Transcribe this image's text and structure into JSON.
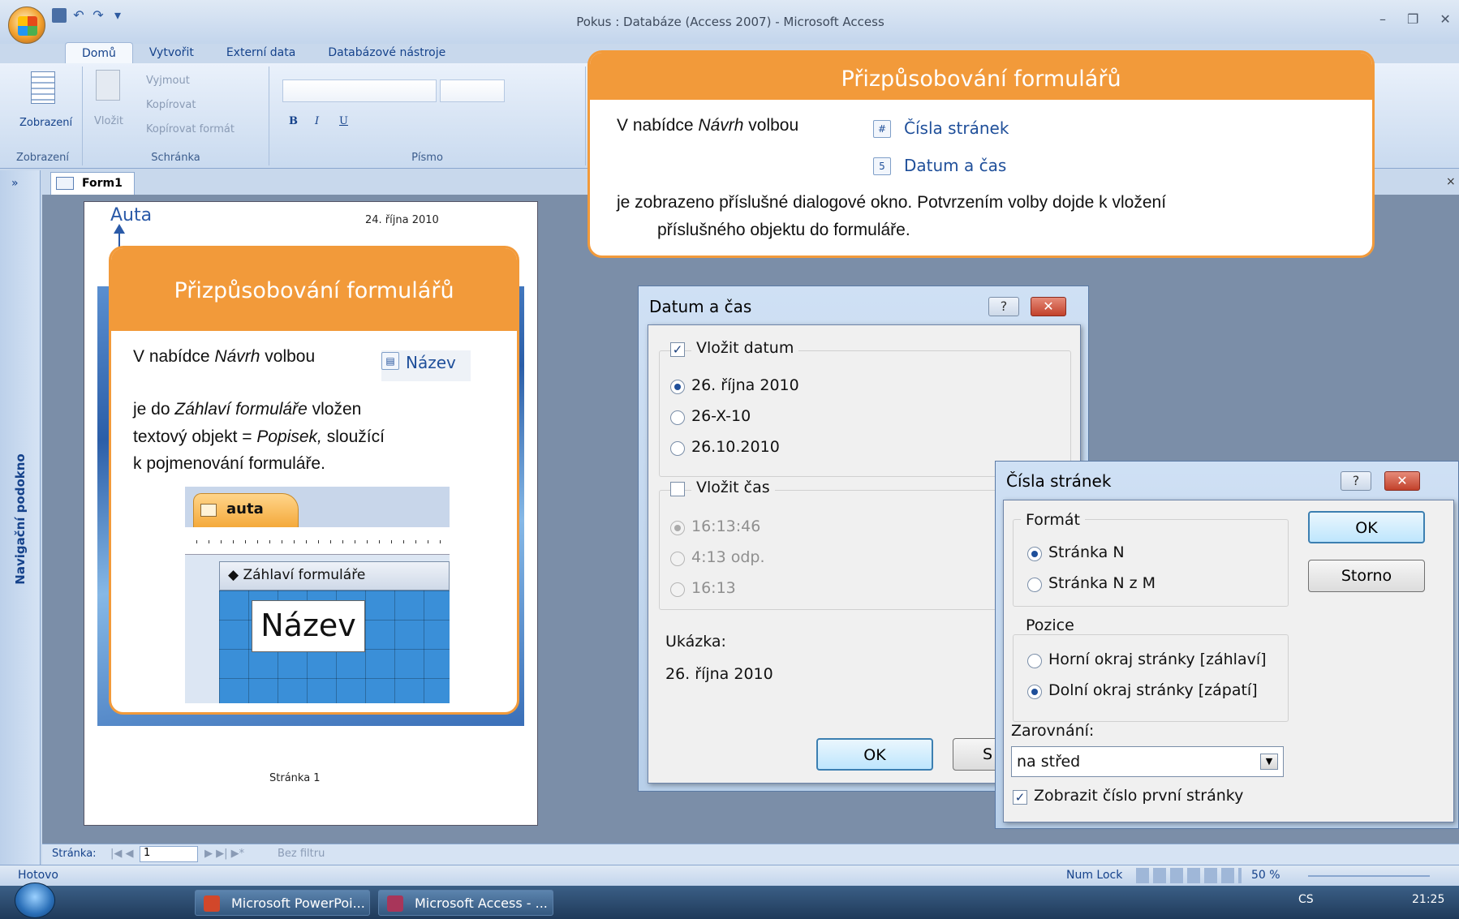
{
  "window": {
    "title": "Pokus : Databáze (Access 2007) - Microsoft Access"
  },
  "ribbon_tabs": [
    "Domů",
    "Vytvořit",
    "Externí data",
    "Databázové nástroje"
  ],
  "ribbon": {
    "views": {
      "button": "Zobrazení",
      "group": "Zobrazení"
    },
    "clipboard": {
      "paste": "Vložit",
      "cut": "Vyjmout",
      "copy": "Kopírovat",
      "format_painter": "Kopírovat formát",
      "group": "Schránka"
    },
    "font": {
      "group": "Písmo",
      "bold": "B",
      "italic": "I",
      "underline": "U"
    }
  },
  "nav_pane": {
    "label": "Navigační podokno",
    "toggle": "»"
  },
  "document": {
    "tab": "Form1"
  },
  "page": {
    "heading": "Auta",
    "date": "24. října 2010",
    "footer": "Stránka 1"
  },
  "callout_left": {
    "title": "Přizpůsobování formulářů",
    "line1_a": "V nabídce ",
    "line1_b": "Návrh",
    "line1_c": " volbou",
    "cmd": "Název",
    "p2_a": "je do  ",
    "p2_b": "Záhlaví formuláře",
    "p2_c": " vložen",
    "p2_d": "textový objekt = ",
    "p2_e": "Popisek,",
    "p2_f": " sloužící",
    "p2_g": "k pojmenování formuláře.",
    "thumb_tab": "auta",
    "thumb_section": "Záhlaví formuláře",
    "thumb_label": "Název"
  },
  "callout_top": {
    "title": "Přizpůsobování formulářů",
    "line1_a": "V nabídce ",
    "line1_b": "Návrh",
    "line1_c": " volbou",
    "cmd1": "Čísla stránek",
    "cmd2": "Datum a čas",
    "line2": "je zobrazeno  příslušné dialogové okno. Potvrzením volby dojde k vložení",
    "line3": "příslušného objektu do formuláře."
  },
  "dialog_datetime": {
    "title": "Datum a čas",
    "include_date": "Vložit datum",
    "date_opts": [
      "26. října 2010",
      "26-X-10",
      "26.10.2010"
    ],
    "include_time": "Vložit čas",
    "time_opts": [
      "16:13:46",
      "4:13 odp.",
      "16:13"
    ],
    "preview_label": "Ukázka:",
    "preview_value": "26. října 2010",
    "ok": "OK",
    "cancel_partial": "S"
  },
  "dialog_pages": {
    "title": "Čísla stránek",
    "format_label": "Formát",
    "format_opts": [
      "Stránka N",
      "Stránka N z M"
    ],
    "position_label": "Pozice",
    "position_opts": [
      "Horní okraj stránky [záhlaví]",
      "Dolní okraj stránky [zápatí]"
    ],
    "align_label": "Zarovnání:",
    "align_value": "na střed",
    "show_first": "Zobrazit číslo první stránky",
    "ok": "OK",
    "cancel": "Storno"
  },
  "record_nav": {
    "label": "Stránka:",
    "value": "1",
    "filter": "Bez filtru"
  },
  "status": {
    "left": "Hotovo",
    "numlock": "Num Lock",
    "zoom": "50 %"
  },
  "taskbar": {
    "items": [
      "Microsoft PowerPoi...",
      "Microsoft Access - ..."
    ],
    "lang": "CS",
    "time": "21:25"
  }
}
